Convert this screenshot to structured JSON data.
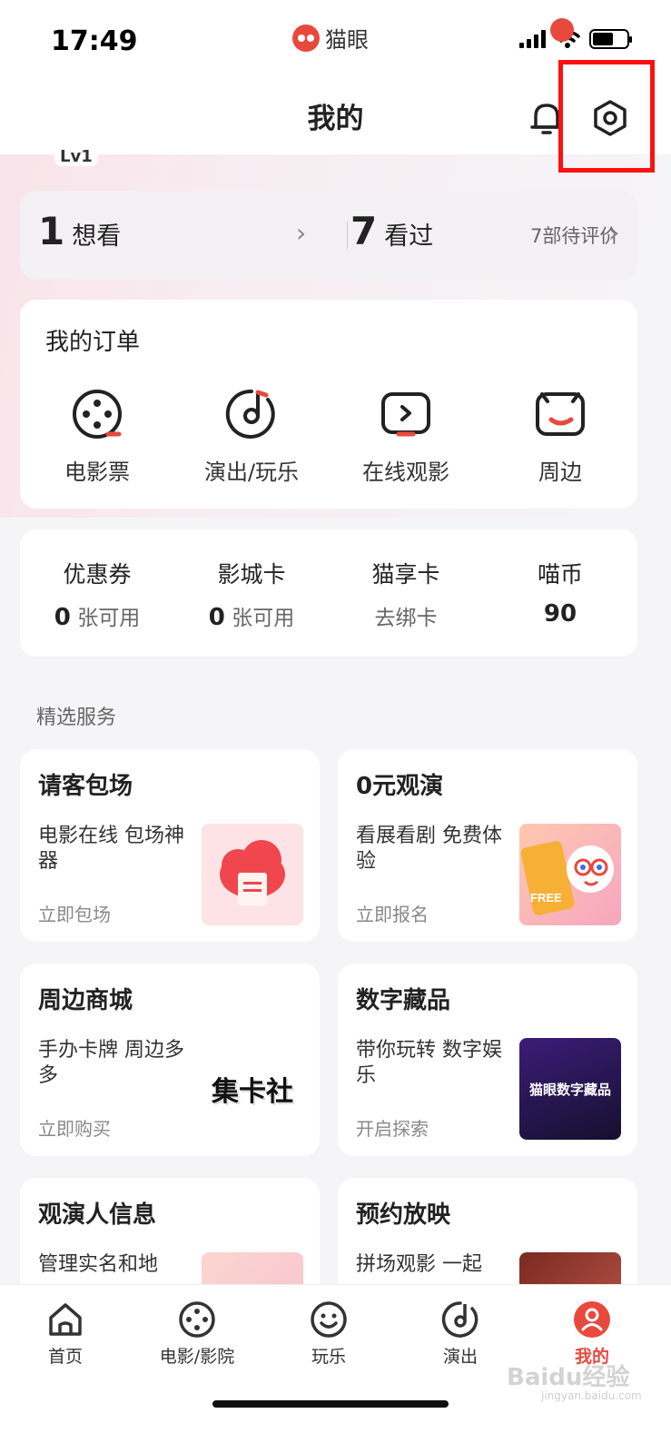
{
  "status_bar": {
    "time": "17:49",
    "app_name": "猫眼"
  },
  "header": {
    "title": "我的",
    "icons": [
      "bell-icon",
      "settings-gear-icon"
    ]
  },
  "profile": {
    "level": "Lv1"
  },
  "watch_summary": {
    "want_count": "1",
    "want_label": "想看",
    "watched_count": "7",
    "watched_label": "看过",
    "pending_review": "7部待评价"
  },
  "orders": {
    "title": "我的订单",
    "items": [
      {
        "label": "电影票",
        "icon": "film-reel-icon"
      },
      {
        "label": "演出/玩乐",
        "icon": "music-disc-icon"
      },
      {
        "label": "在线观影",
        "icon": "play-screen-icon"
      },
      {
        "label": "周边",
        "icon": "bag-icon"
      }
    ]
  },
  "assets": [
    {
      "title": "优惠券",
      "value": "0",
      "unit": "张可用"
    },
    {
      "title": "影城卡",
      "value": "0",
      "unit": "张可用"
    },
    {
      "title": "猫享卡",
      "value": "",
      "unit": "去绑卡"
    },
    {
      "title": "喵币",
      "value": "90",
      "unit": ""
    }
  ],
  "services": {
    "heading": "精选服务",
    "items": [
      {
        "title": "请客包场",
        "desc": "电影在线 包场神器",
        "cta": "立即包场"
      },
      {
        "title": "0元观演",
        "desc": "看展看剧 免费体验",
        "cta": "立即报名",
        "badge": "FREE"
      },
      {
        "title": "周边商城",
        "desc": "手办卡牌 周边多多",
        "cta": "立即购买",
        "logo": "集卡社"
      },
      {
        "title": "数字藏品",
        "desc": "带你玩转 数字娱乐",
        "cta": "开启探索",
        "logo": "猫眼数字藏品"
      },
      {
        "title": "观演人信息",
        "desc": "管理实名和地"
      },
      {
        "title": "预约放映",
        "desc": "拼场观影 一起"
      }
    ]
  },
  "tabbar": {
    "items": [
      {
        "label": "首页",
        "icon": "home-icon"
      },
      {
        "label": "电影/影院",
        "icon": "film-reel-icon"
      },
      {
        "label": "玩乐",
        "icon": "smile-icon"
      },
      {
        "label": "演出",
        "icon": "music-disc-icon"
      },
      {
        "label": "我的",
        "icon": "user-icon",
        "active": true
      }
    ]
  },
  "watermark": {
    "text": "Baidu经验",
    "url_text": "jingyan.baidu.com"
  },
  "colors": {
    "brand": "#e8493d",
    "highlight": "#ff1010"
  }
}
